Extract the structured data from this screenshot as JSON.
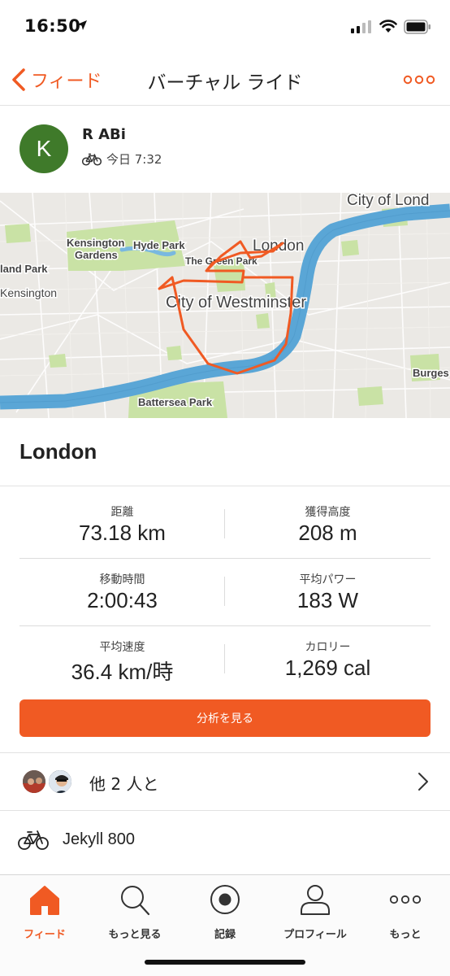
{
  "status_bar": {
    "time": "16:50"
  },
  "header": {
    "back_label": "フィード",
    "title": "バーチャル ライド"
  },
  "athlete": {
    "avatar_initial": "K",
    "name": "R ABi",
    "activity_time": "今日 7:32"
  },
  "map": {
    "labels": {
      "city_of_london": "City of Lond",
      "kensington_gardens_1": "Kensington",
      "kensington_gardens_2": "Gardens",
      "hyde_park": "Hyde Park",
      "holland_park": "land Park",
      "kensington": "Kensington",
      "green_park": "The Green Park",
      "london": "London",
      "westminster": "City of Westminster",
      "burgess": "Burges",
      "battersea": "Battersea Park"
    }
  },
  "activity": {
    "title": "London",
    "stats": [
      {
        "left_label": "距離",
        "left_value": "73.18 km",
        "right_label": "獲得高度",
        "right_value": "208 m"
      },
      {
        "left_label": "移動時間",
        "left_value": "2:00:43",
        "right_label": "平均パワー",
        "right_value": "183 W"
      },
      {
        "left_label": "平均速度",
        "left_value": "36.4 km/時",
        "right_label": "カロリー",
        "right_value": "1,269 cal"
      }
    ],
    "analysis_button": "分析を見る"
  },
  "group": {
    "text": "他 2 人と"
  },
  "gear": {
    "name": "Jekyll 800"
  },
  "tab_bar": {
    "tabs": [
      {
        "label": "フィード",
        "icon": "home-icon"
      },
      {
        "label": "もっと見る",
        "icon": "search-icon"
      },
      {
        "label": "記録",
        "icon": "record-icon"
      },
      {
        "label": "プロフィール",
        "icon": "profile-icon"
      },
      {
        "label": "もっと",
        "icon": "more-icon"
      }
    ]
  },
  "colors": {
    "accent": "#f05a23",
    "avatar_bg": "#3f7a2a",
    "river": "#5aa6d6",
    "park": "#c8e0a4",
    "route": "#f05a23"
  }
}
